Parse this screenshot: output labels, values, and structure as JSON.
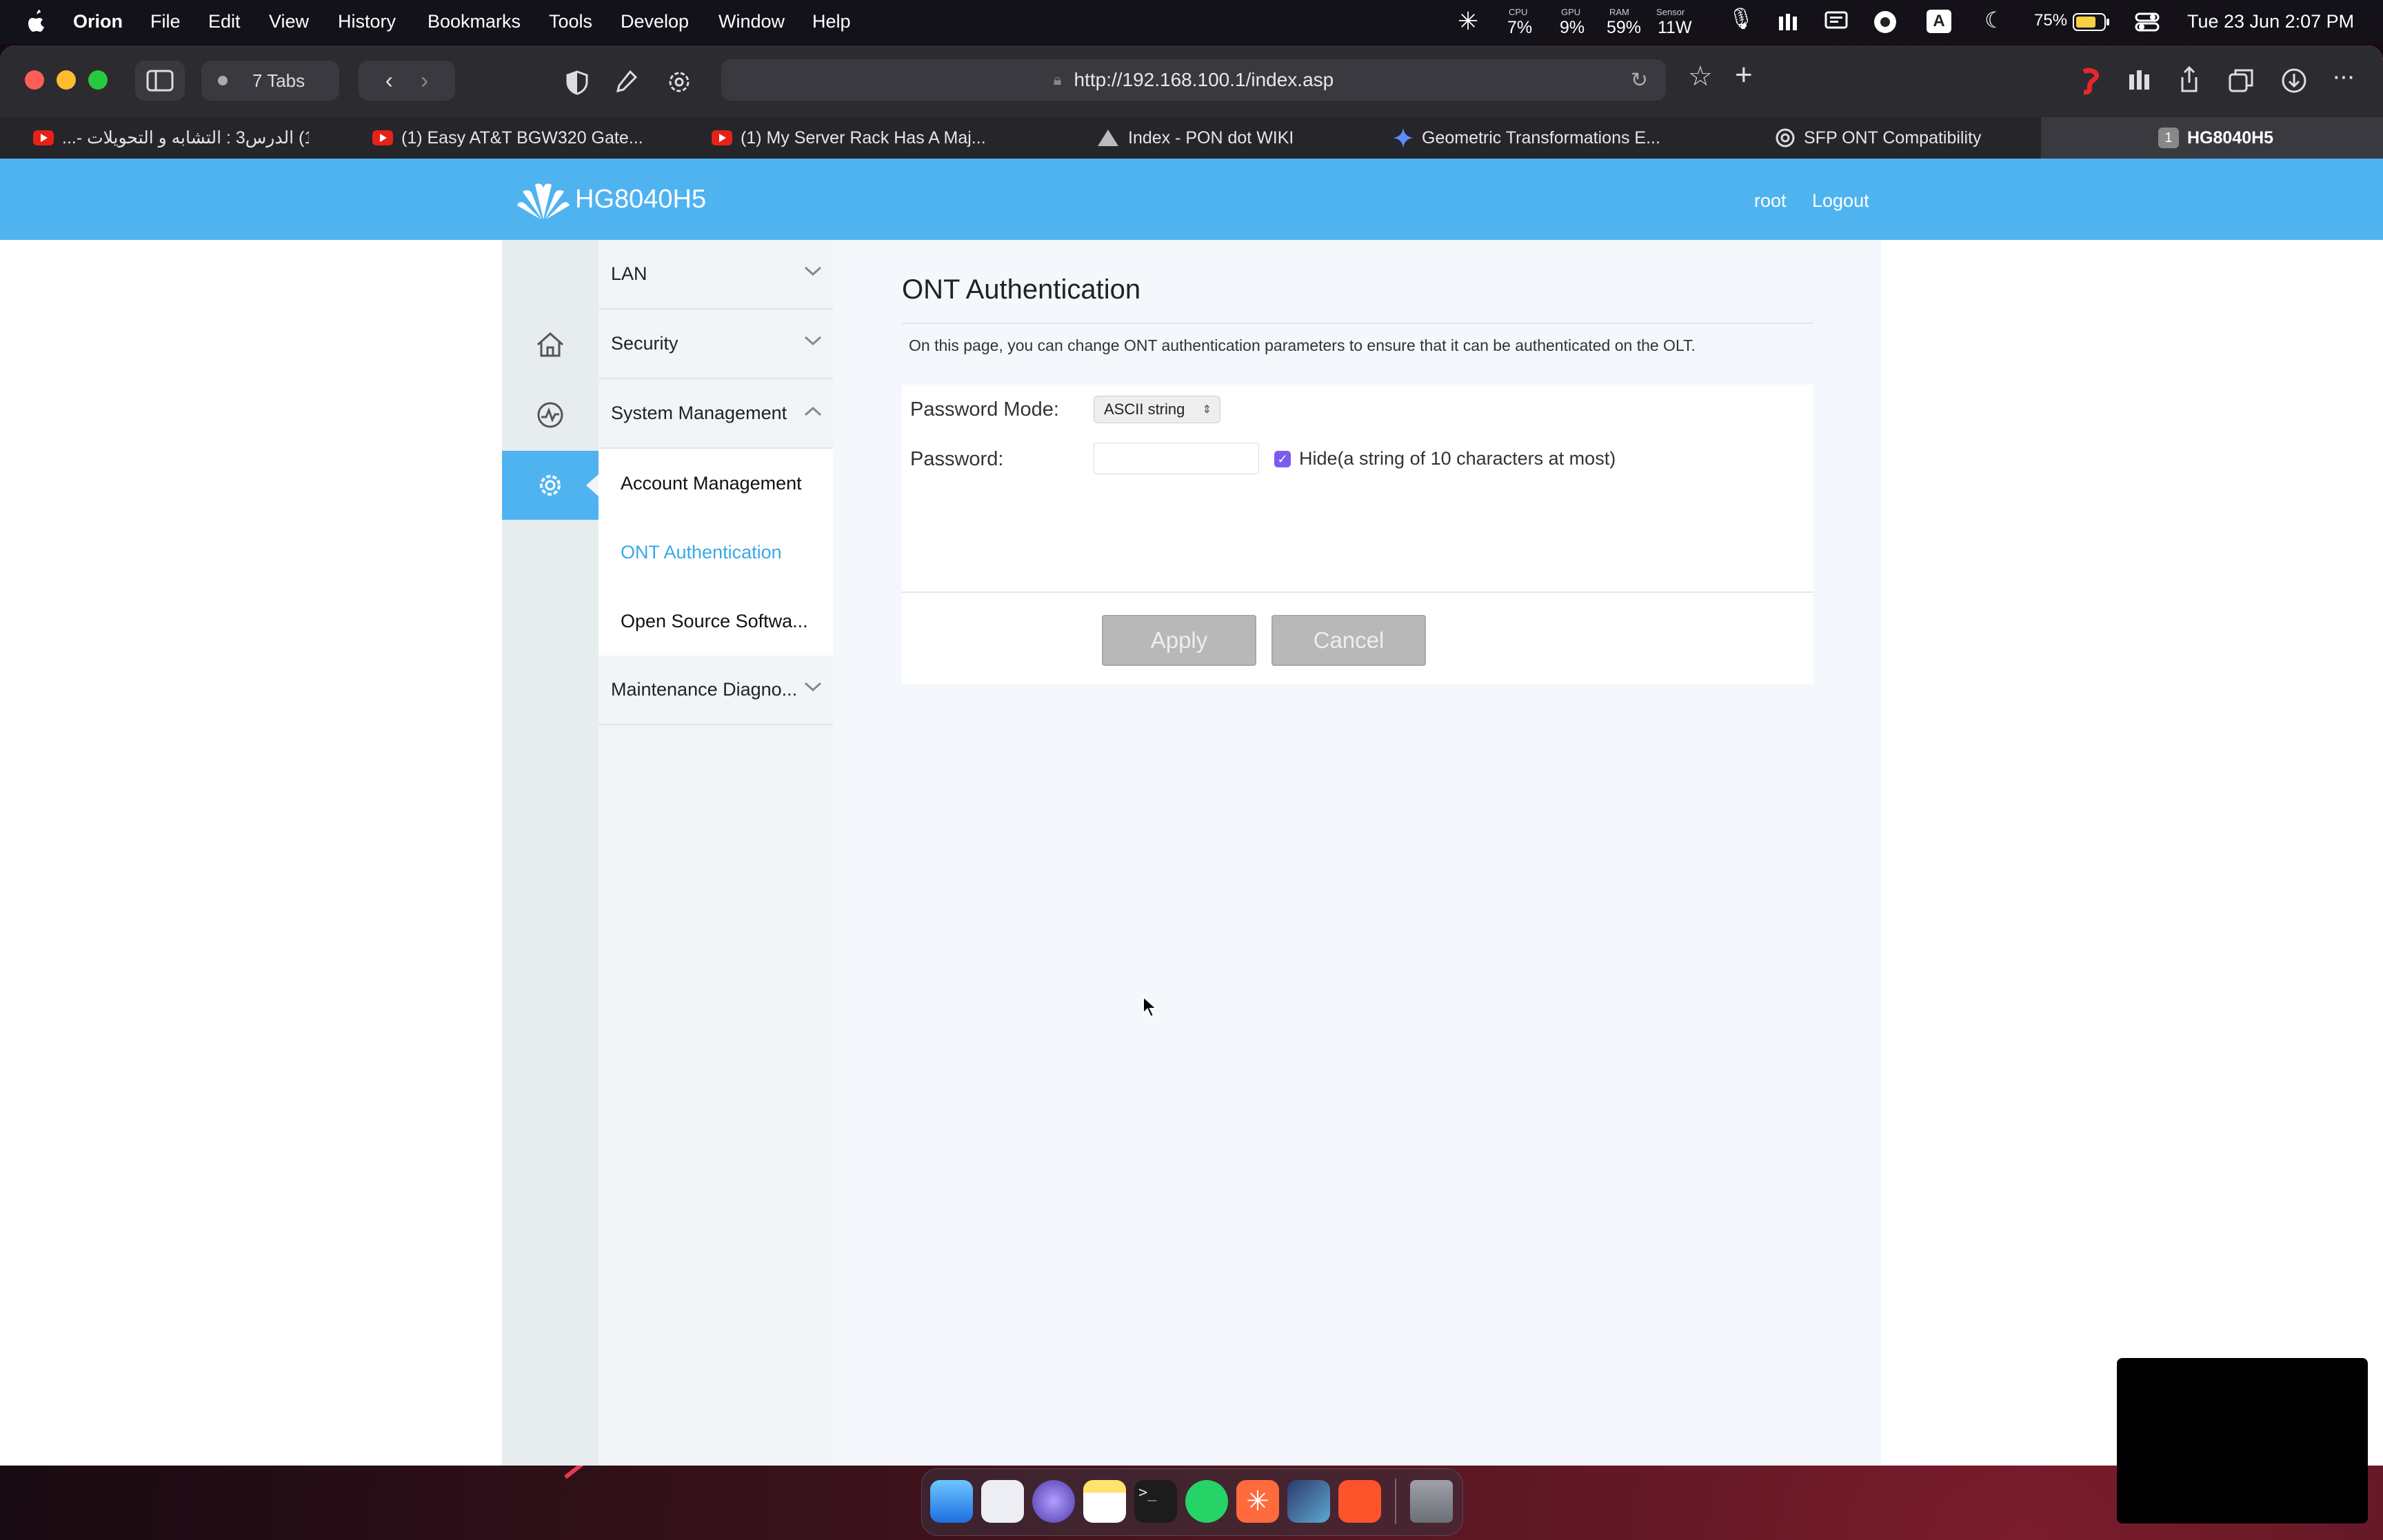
{
  "menubar": {
    "app": "Orion",
    "menus": [
      "File",
      "Edit",
      "View",
      "History",
      "Bookmarks",
      "Tools",
      "Develop",
      "Window",
      "Help"
    ],
    "status": {
      "cpu_label": "CPU",
      "cpu": "7%",
      "gpu_label": "GPU",
      "gpu": "9%",
      "ram_label": "RAM",
      "ram": "59%",
      "sensor_label": "Sensor",
      "sensor": "11W",
      "battery": "75%",
      "keyboard": "A",
      "datetime": "Tue 23 Jun  2:07 PM"
    }
  },
  "browser": {
    "tabs_count": "7 Tabs",
    "url": "http://192.168.100.1/index.asp",
    "tabs": [
      {
        "label": "(1) الدرس3 : التشابه و التحويلات -...",
        "icon": "youtube-icon"
      },
      {
        "label": "(1) Easy AT&T BGW320 Gate...",
        "icon": "youtube-icon"
      },
      {
        "label": "(1) My Server Rack Has A Maj...",
        "icon": "youtube-icon"
      },
      {
        "label": "Index - PON dot WIKI",
        "icon": "triangle-icon"
      },
      {
        "label": "Geometric Transformations E...",
        "icon": "gemini-icon"
      },
      {
        "label": "SFP ONT Compatibility",
        "icon": "openai-icon"
      },
      {
        "label": "HG8040H5",
        "icon": "number-badge-icon",
        "badge": "1",
        "active": true
      }
    ]
  },
  "router": {
    "product": "HG8040H5",
    "user": "root",
    "logout": "Logout",
    "nav": {
      "lan": "LAN",
      "security": "Security",
      "system_management": "System Management",
      "sub": {
        "account": "Account Management",
        "ont_auth": "ONT Authentication",
        "open_source": "Open Source Softwa..."
      },
      "maintenance": "Maintenance Diagno..."
    },
    "page": {
      "title": "ONT Authentication",
      "description": "On this page, you can change ONT authentication parameters to ensure that it can be authenticated on the OLT.",
      "password_mode_label": "Password Mode:",
      "password_mode_value": "ASCII string",
      "password_label": "Password:",
      "password_value": "",
      "hide_label": "Hide(a string of 10 characters at most)",
      "hide_checked": true,
      "apply": "Apply",
      "cancel": "Cancel"
    }
  },
  "colors": {
    "banner": "#4fb3f0",
    "active_link": "#3aa8e8",
    "button_disabled": "#b8b8b8"
  }
}
